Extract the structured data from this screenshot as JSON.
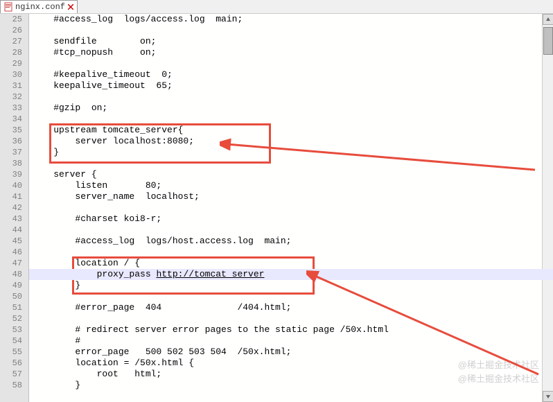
{
  "tab": {
    "name": "nginx.conf"
  },
  "lines": [
    {
      "num": 25,
      "text": "    #access_log  logs/access.log  main;"
    },
    {
      "num": 26,
      "text": ""
    },
    {
      "num": 27,
      "text": "    sendfile        on;"
    },
    {
      "num": 28,
      "text": "    #tcp_nopush     on;"
    },
    {
      "num": 29,
      "text": ""
    },
    {
      "num": 30,
      "text": "    #keepalive_timeout  0;"
    },
    {
      "num": 31,
      "text": "    keepalive_timeout  65;"
    },
    {
      "num": 32,
      "text": ""
    },
    {
      "num": 33,
      "text": "    #gzip  on;"
    },
    {
      "num": 34,
      "text": ""
    },
    {
      "num": 35,
      "text": "    upstream tomcate_server{"
    },
    {
      "num": 36,
      "text": "        server localhost:8080;"
    },
    {
      "num": 37,
      "text": "    }"
    },
    {
      "num": 38,
      "text": ""
    },
    {
      "num": 39,
      "text": "    server {"
    },
    {
      "num": 40,
      "text": "        listen       80;"
    },
    {
      "num": 41,
      "text": "        server_name  localhost;"
    },
    {
      "num": 42,
      "text": ""
    },
    {
      "num": 43,
      "text": "        #charset koi8-r;"
    },
    {
      "num": 44,
      "text": ""
    },
    {
      "num": 45,
      "text": "        #access_log  logs/host.access.log  main;"
    },
    {
      "num": 46,
      "text": ""
    },
    {
      "num": 47,
      "text": "        location / {"
    },
    {
      "num": 48,
      "text": "            proxy_pass ",
      "link": "http://tomcat_server",
      "hl": true
    },
    {
      "num": 49,
      "text": "        }"
    },
    {
      "num": 50,
      "text": ""
    },
    {
      "num": 51,
      "text": "        #error_page  404              /404.html;"
    },
    {
      "num": 52,
      "text": ""
    },
    {
      "num": 53,
      "text": "        # redirect server error pages to the static page /50x.html"
    },
    {
      "num": 54,
      "text": "        #"
    },
    {
      "num": 55,
      "text": "        error_page   500 502 503 504  /50x.html;"
    },
    {
      "num": 56,
      "text": "        location = /50x.html {"
    },
    {
      "num": 57,
      "text": "            root   html;"
    },
    {
      "num": 58,
      "text": "        }"
    }
  ],
  "watermark": "@稀土掘金技术社区"
}
